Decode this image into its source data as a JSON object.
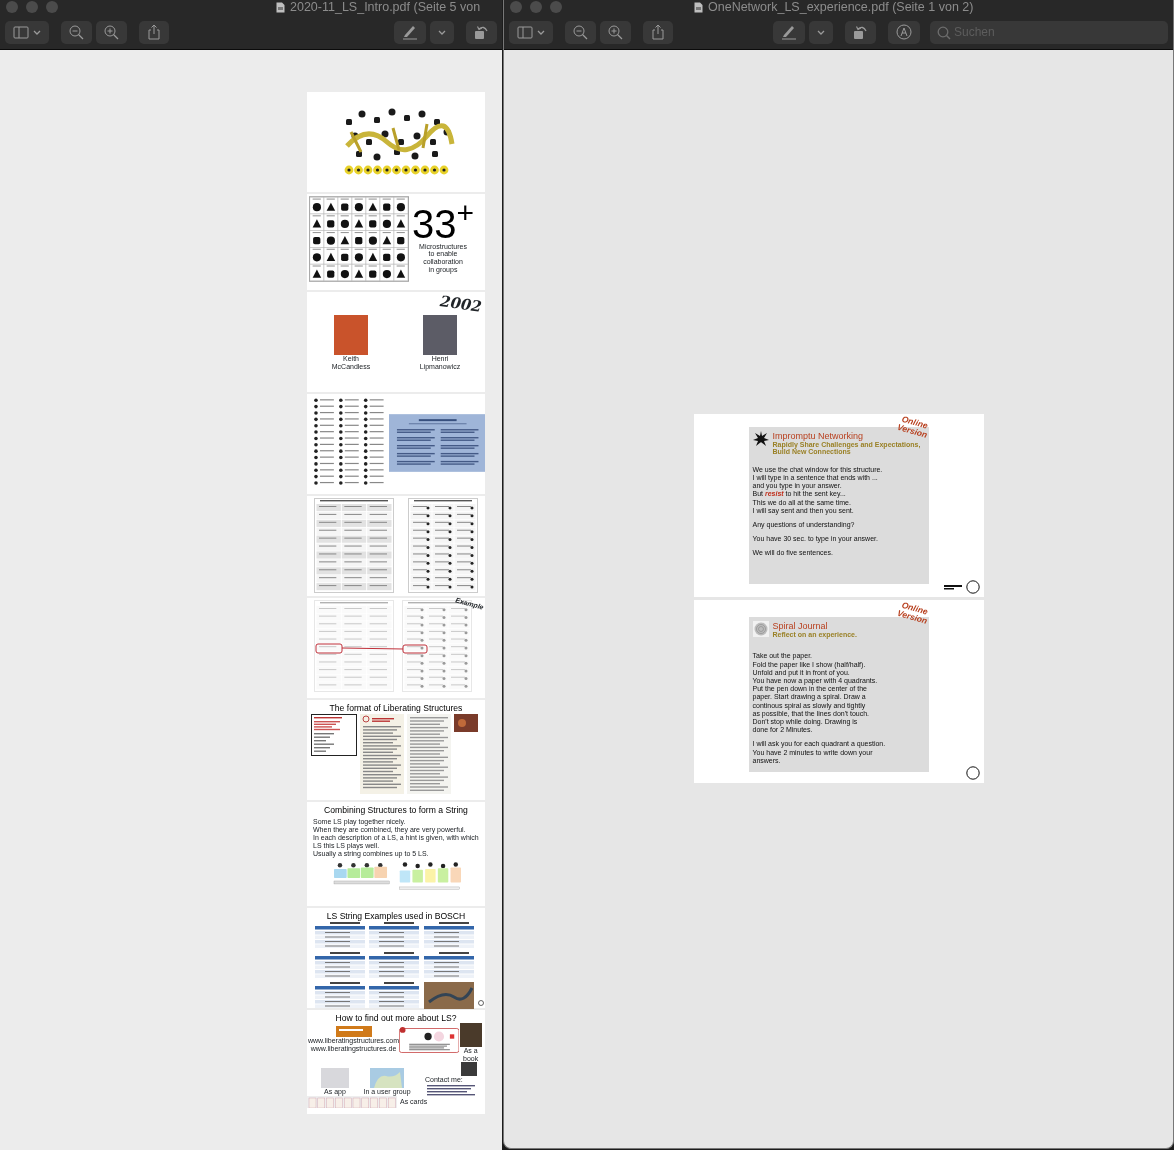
{
  "windows": [
    {
      "title": "2020-11_LS_Intro.pdf (Seite 5 von",
      "kind": "thumbnails",
      "pages": [
        {
          "kind": "logo"
        },
        {
          "kind": "count",
          "count": "33$^{+}$",
          "caption": "Microstructures\nto enable\ncollaboration\nin groups"
        },
        {
          "kind": "people",
          "year": "2002",
          "people": [
            {
              "name": "Keith\nMcCandless"
            },
            {
              "name": "Henri\nLipmanowicz"
            }
          ]
        },
        {
          "kind": "overview"
        },
        {
          "kind": "grids"
        },
        {
          "kind": "example",
          "note": "Example"
        },
        {
          "kind": "format",
          "title": "The format of Liberating Structures"
        },
        {
          "kind": "string",
          "title": "Combining Structures to form a String",
          "text": "Some LS play together nicely.\nWhen they are combined, they are very powerful.\nIn each description of a LS, a hint is given, with which LS this LS plays well.\nUsually a string combines up to 5 LS."
        },
        {
          "kind": "examples",
          "title": "LS String Examples used in BOSCH"
        },
        {
          "kind": "more",
          "title": "How to find out more about LS?",
          "website": "www.liberatingstructures.com\nwww.liberatingstructures.de",
          "book": "As a book",
          "app": "As app",
          "group": "In a user group",
          "contact": "Contact me:",
          "cards": "As cards"
        }
      ]
    },
    {
      "title": "OneNetwork_LS_experience.pdf (Seite 1 von 2)",
      "kind": "slides",
      "search": {
        "placeholder": "Suchen"
      },
      "slides": [
        {
          "kind": "networking",
          "badge": "Online\nVersion",
          "title": "Impromptu Networking",
          "subtitle": "Rapidly Share Challenges and Expectations,\nBuild New Connections",
          "paragraphs": [
            "We use the chat window for this structure.\nI will type in a sentence that ends with ...\nand you type in your answer.\nBut **resist** to hit the sent key...\nThis we do all at the same time.\nI will say sent and then you sent.",
            "Any questions of understanding?",
            "You have 30 sec. to type in your answer.",
            "We will do five sentences."
          ]
        },
        {
          "kind": "spiral",
          "badge": "Online\nVersion",
          "title": "Spiral Journal",
          "subtitle": "Reflect on an experience.",
          "paragraphs": [
            "Take out the paper.\nFold the paper like I show (half/half).\nUnfold and put it in front of you.\nYou have now a paper with 4 quadrants.\nPut the pen down in the center of the\npaper. Start drawing a spiral. Draw a\ncontinous spiral as slowly and tightly\nas possible, that the lines don't touch.\nDon't stop while doing. Drawing is\ndone for 2 Minutes.",
            "I will ask you for each quadrant a question.\nYou have 2 minutes to write down your\nanswers."
          ]
        }
      ]
    }
  ]
}
